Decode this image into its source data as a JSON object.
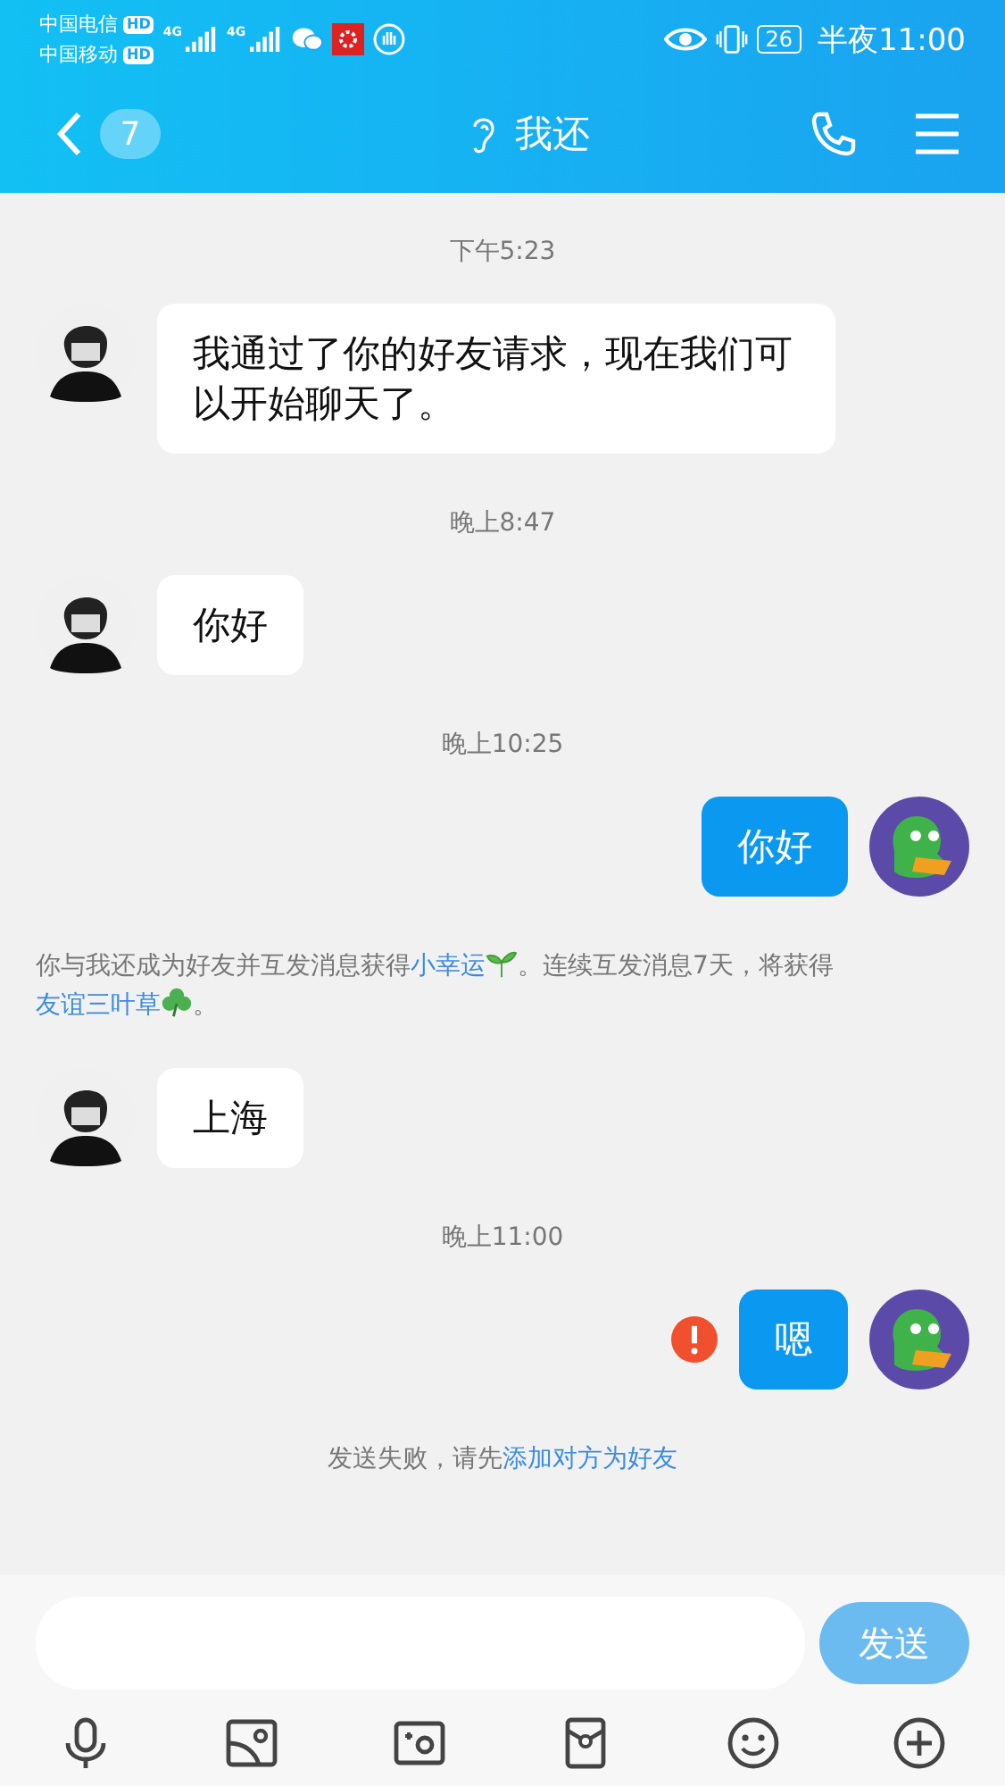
{
  "status_bar": {
    "carriers": [
      {
        "name": "中国电信",
        "badge": "HD"
      },
      {
        "name": "中国移动",
        "badge": "HD"
      }
    ],
    "networks": [
      "4G",
      "4G"
    ],
    "battery": "26",
    "time": "半夜11:00"
  },
  "header": {
    "unread": "7",
    "title": "我还"
  },
  "messages": [
    {
      "kind": "time",
      "text": "下午5:23"
    },
    {
      "kind": "message",
      "from_me": false,
      "text": "我通过了你的好友请求，现在我们可以开始聊天了。",
      "failed": false
    },
    {
      "kind": "time",
      "text": "晚上8:47"
    },
    {
      "kind": "message",
      "from_me": false,
      "text": "你好",
      "failed": false
    },
    {
      "kind": "time",
      "text": "晚上10:25"
    },
    {
      "kind": "message",
      "from_me": true,
      "text": "你好",
      "failed": false
    },
    {
      "kind": "notice",
      "segments": [
        {
          "kind": "text",
          "text": "你与我还成为好友并互发消息获得"
        },
        {
          "kind": "link",
          "text": "小幸运"
        },
        {
          "kind": "sprout"
        },
        {
          "kind": "text",
          "text": "。连续互发消息7天，将获得"
        },
        {
          "kind": "link",
          "text": "友谊三叶草"
        },
        {
          "kind": "clover"
        },
        {
          "kind": "text",
          "text": "。"
        }
      ]
    },
    {
      "kind": "message",
      "from_me": false,
      "text": "上海",
      "failed": false
    },
    {
      "kind": "time",
      "text": "晚上11:00"
    },
    {
      "kind": "message",
      "from_me": true,
      "text": "嗯",
      "failed": true
    },
    {
      "kind": "notice",
      "segments": [
        {
          "kind": "text",
          "text": "发送失败，请先"
        },
        {
          "kind": "link",
          "text": "添加对方为好友"
        }
      ]
    }
  ],
  "composer": {
    "send": "发送"
  }
}
